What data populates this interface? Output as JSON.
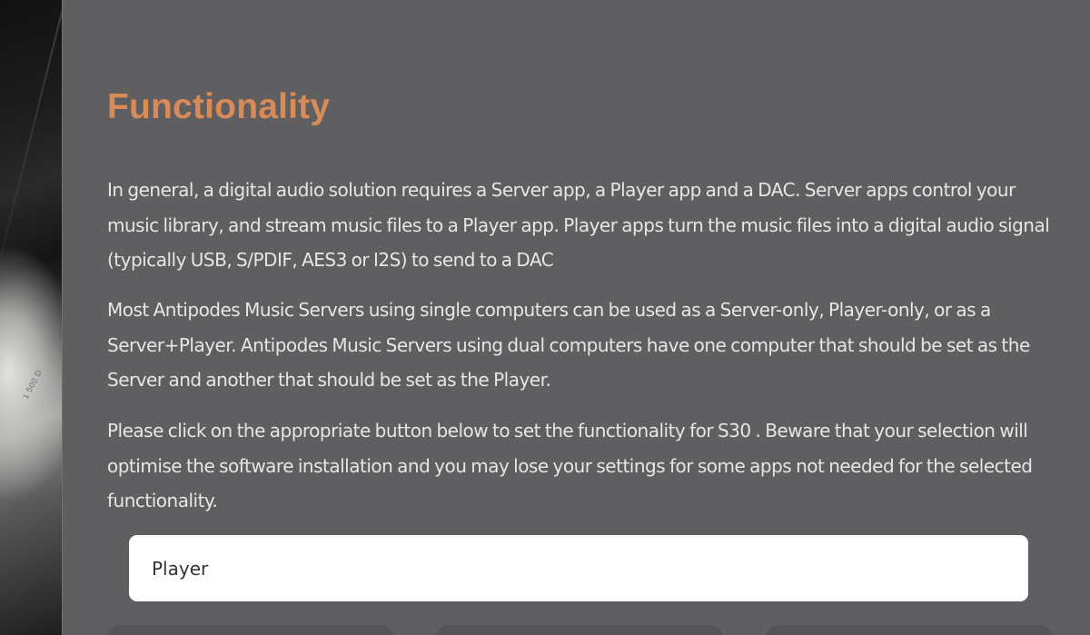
{
  "background": {
    "dial_label": "1 500 D"
  },
  "panel": {
    "title": "Functionality",
    "paragraphs": [
      "In general, a digital audio solution requires a Server app, a Player app and a DAC. Server apps control your music library, and stream music files to a Player app. Player apps turn the music files into a digital audio signal (typically USB, S/PDIF, AES3 or I2S) to send to a DAC",
      "Most Antipodes Music Servers using single computers can be used as a Server-only, Player-only, or as a Server+Player. Antipodes Music Servers using dual computers have one computer that should be set as the Server and another that should be set as the Player.",
      "Please click on the appropriate button below to set the functionality for S30 . Beware that your selection will optimise the software installation and you may lose your settings for some apps not needed for the selected functionality."
    ],
    "option_button_label": "Player"
  },
  "colors": {
    "panel_bg": "#5f5f61",
    "title_accent": "#d98b57",
    "body_text": "#e6e6e6",
    "button_bg": "#ffffff"
  }
}
